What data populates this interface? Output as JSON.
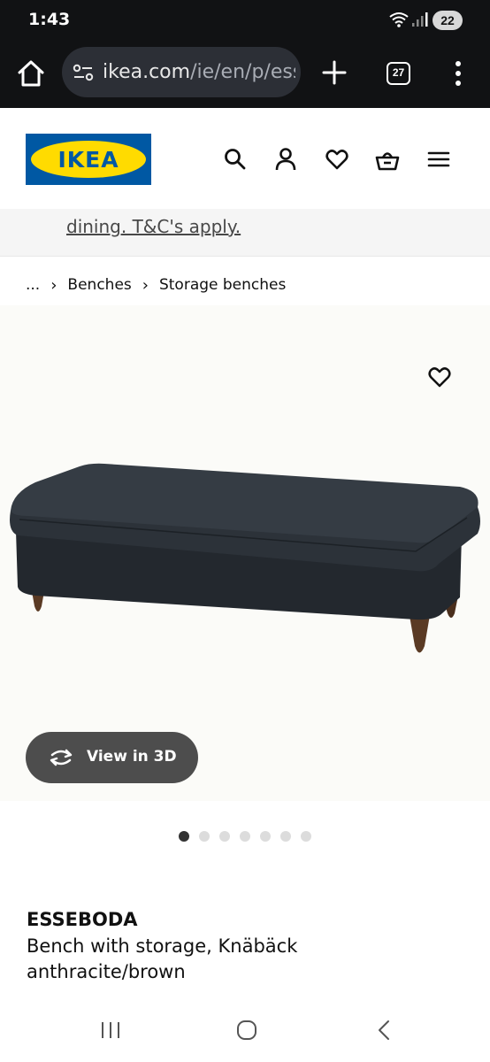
{
  "status_bar": {
    "time": "1:43",
    "battery": "22",
    "wifi_icon": "wifi-icon",
    "signal_icon": "signal-icon"
  },
  "browser": {
    "url_host": "ikea.com",
    "url_path": "/ie/en/p/esseboda",
    "tab_count": "27",
    "icons": [
      "home-icon",
      "site-settings-icon",
      "plus-icon",
      "tabs-icon",
      "more-vert-icon"
    ]
  },
  "header": {
    "logo_text": "IKEA",
    "icons": [
      "search-icon",
      "account-icon",
      "heart-icon",
      "basket-icon",
      "hamburger-icon"
    ],
    "colors": {
      "logo_blue": "#0058a3",
      "logo_yellow": "#ffdb00"
    }
  },
  "promo": {
    "link_text": "dining. T&C's apply."
  },
  "breadcrumb": {
    "ellipsis": "...",
    "items": [
      "Benches",
      "Storage benches"
    ]
  },
  "gallery": {
    "view_3d_label": "View in 3D",
    "dot_count": 7,
    "active_dot": 0
  },
  "product": {
    "name": "ESSEBODA",
    "description": "Bench with storage, Knäbäck anthracite/brown"
  },
  "nav_bar": {
    "icons": [
      "recents-icon",
      "home-nav-icon",
      "back-icon"
    ]
  }
}
